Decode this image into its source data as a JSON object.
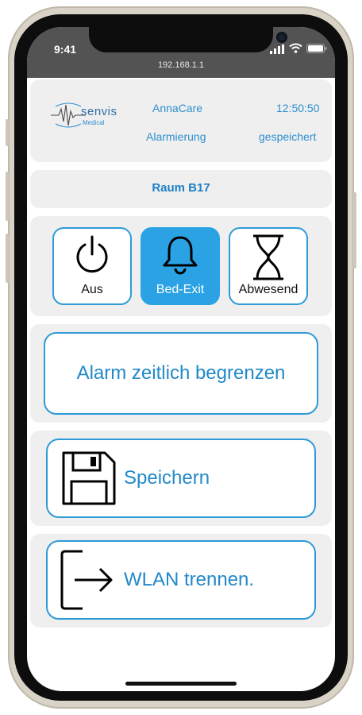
{
  "status": {
    "time": "9:41",
    "url": "192.168.1.1"
  },
  "header": {
    "logo_text": "senvis",
    "logo_sub": "Medical",
    "app_name": "AnnaCare",
    "clock": "12:50:50",
    "subtitle": "Alarmierung",
    "save_state": "gespeichert"
  },
  "room": {
    "label": "Raum B17"
  },
  "modes": [
    {
      "label": "Aus",
      "icon": "power-icon",
      "active": false
    },
    {
      "label": "Bed-Exit",
      "icon": "bell-icon",
      "active": true
    },
    {
      "label": "Abwesend",
      "icon": "hourglass-icon",
      "active": false
    }
  ],
  "actions": {
    "limit_label": "Alarm zeitlich begrenzen",
    "save_label": "Speichern",
    "disconnect_label": "WLAN trennen."
  },
  "colors": {
    "accent": "#2aa2e4",
    "text_accent": "#2289c8",
    "card_bg": "#efefef"
  }
}
